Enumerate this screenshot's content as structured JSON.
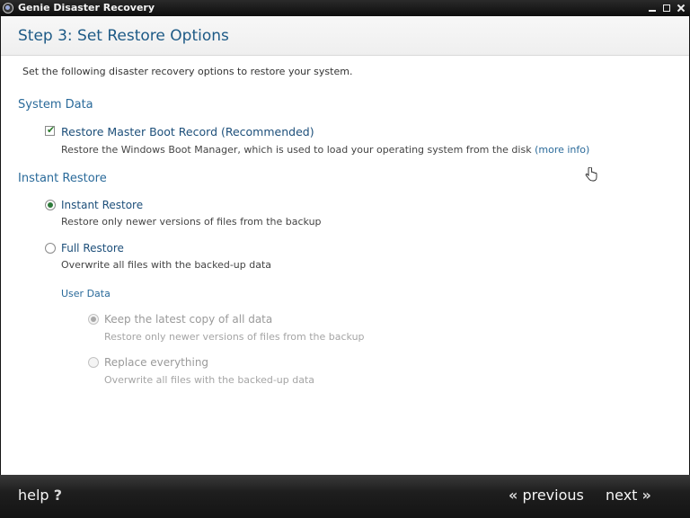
{
  "window": {
    "title": "Genie Disaster Recovery"
  },
  "step": {
    "title": "Step 3: Set Restore Options",
    "intro": "Set the following disaster recovery options to restore your system."
  },
  "system_data": {
    "title": "System Data",
    "restore_mbr": {
      "label": "Restore Master Boot Record (Recommended)",
      "description": "Restore the Windows Boot Manager, which is used to load your operating system from the disk",
      "link": "(more info)",
      "checked": true
    }
  },
  "instant_restore": {
    "title": "Instant Restore",
    "options": [
      {
        "label": "Instant Restore",
        "description": "Restore only newer versions of files from the backup",
        "selected": true
      },
      {
        "label": "Full Restore",
        "description": "Overwrite all files with the backed-up data",
        "selected": false
      }
    ]
  },
  "user_data": {
    "title": "User Data",
    "options": [
      {
        "label": "Keep the latest copy of all data",
        "description": "Restore only newer versions of files from the backup",
        "selected": true,
        "disabled": true
      },
      {
        "label": "Replace everything",
        "description": "Overwrite all files with the backed-up data",
        "selected": false,
        "disabled": true
      }
    ]
  },
  "footer": {
    "help": "help",
    "help_icon": "?",
    "previous": "previous",
    "previous_icon": "«",
    "next": "next",
    "next_icon": "»"
  },
  "colors": {
    "accent": "#1d5a86",
    "selected_radio": "#2e7a3a"
  }
}
